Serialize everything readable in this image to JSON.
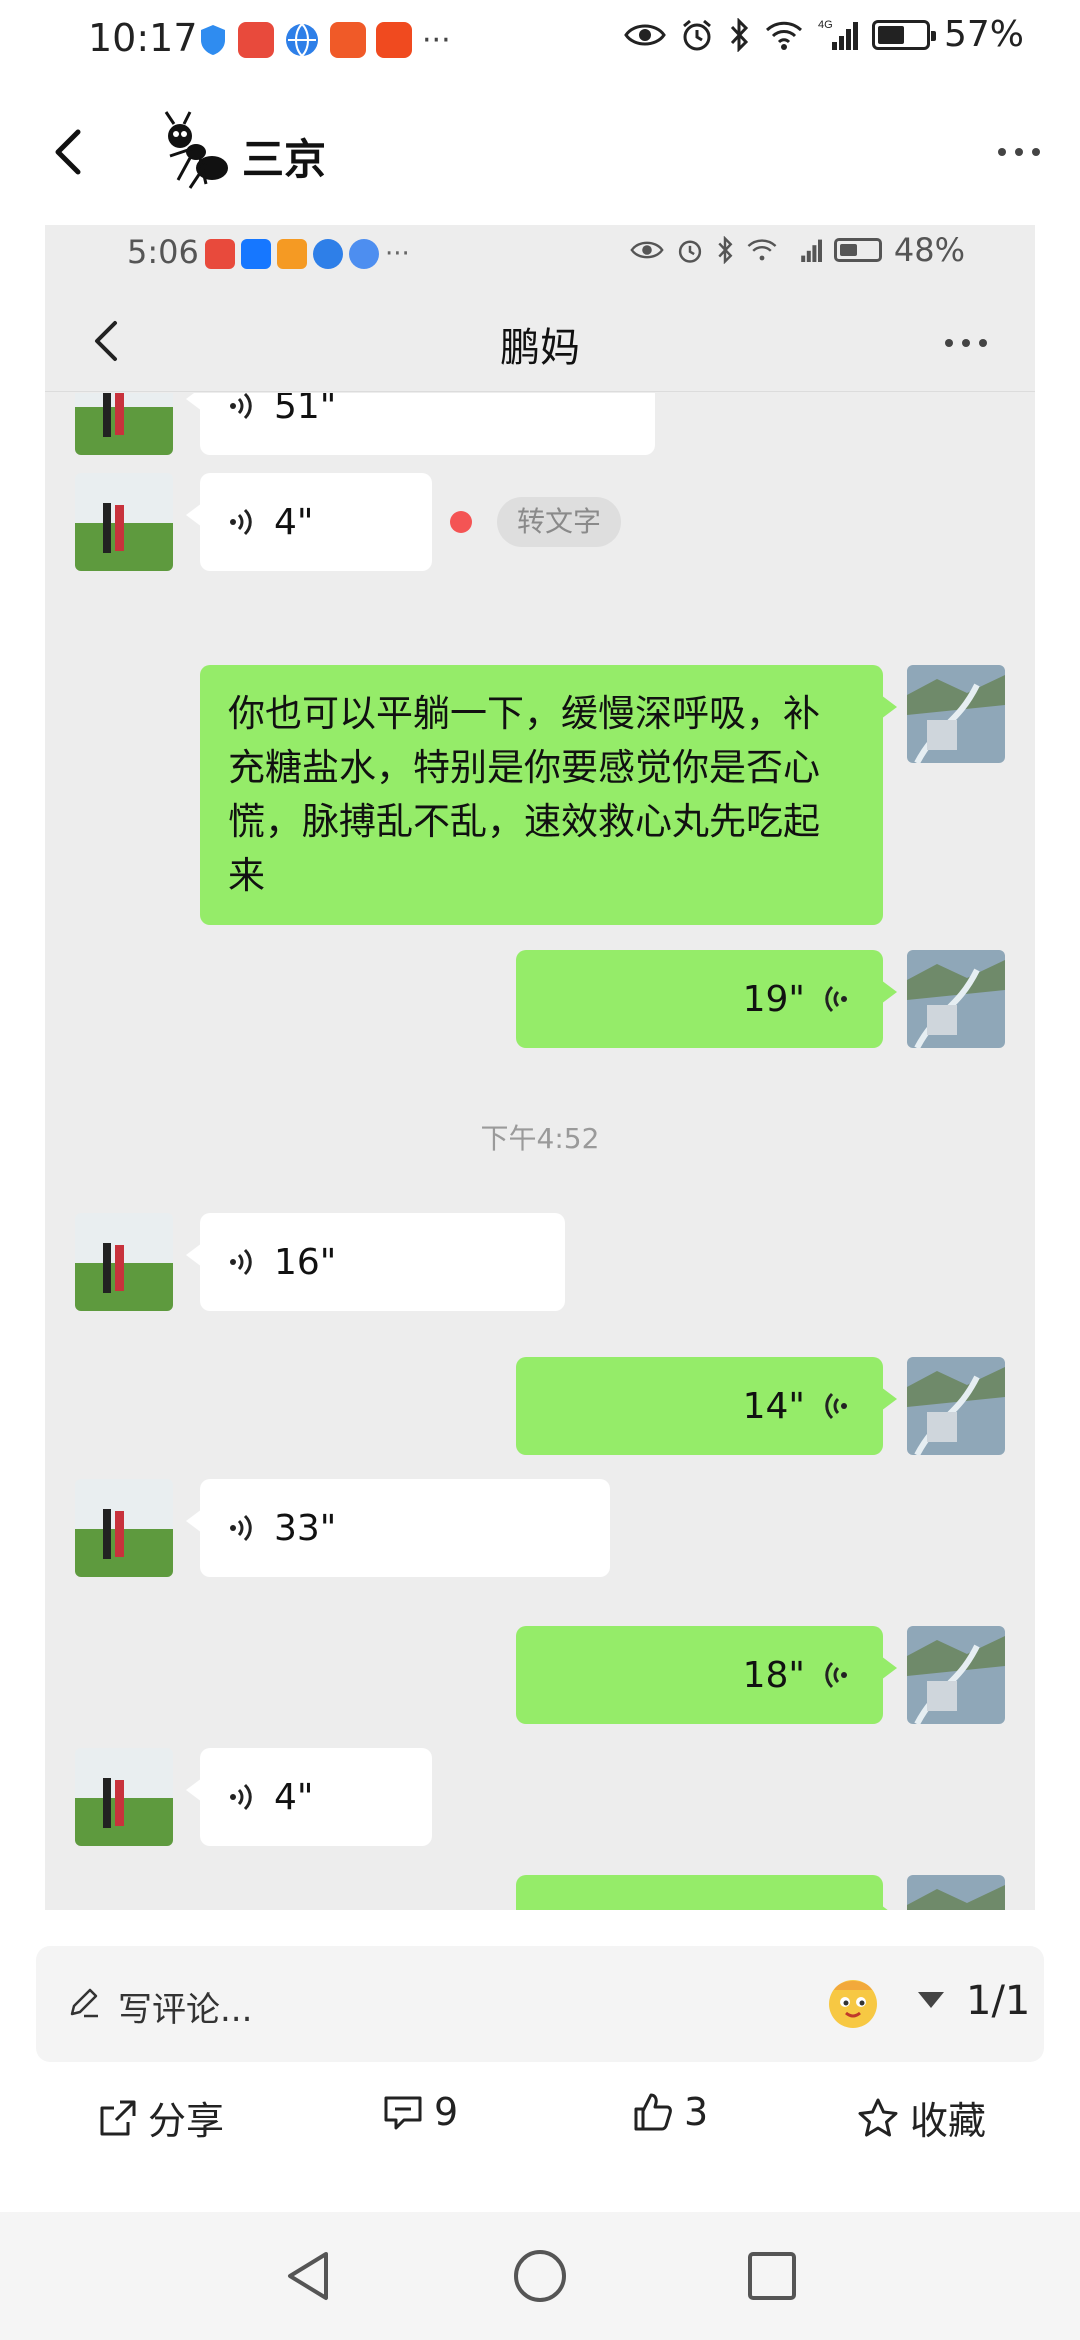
{
  "status_bar": {
    "time": "10:17",
    "battery": "57%",
    "battery_level": 0.57,
    "more_notifications": "···",
    "notification_icons": [
      "shield-icon",
      "huawei-app-icon",
      "browser-icon",
      "pingan-securities-icon",
      "pingan-bank-icon"
    ]
  },
  "header": {
    "author": "三京"
  },
  "screenshot": {
    "status_time": "5:06",
    "status_more": "···",
    "status_battery": "48%",
    "battery_level": 0.48,
    "chat_title": "鹏妈",
    "messages": {
      "m1_duration": "51\"",
      "m2_duration": "4\"",
      "m2_convert": "转文字",
      "m3_text": "你也可以平躺一下，缓慢深呼吸，补充糖盐水，特别是你要感觉你是否心慌，脉搏乱不乱，速效救心丸先吃起来",
      "m4_duration": "19\"",
      "time_separator": "下午4:52",
      "m5_duration": "16\"",
      "m6_duration": "14\"",
      "m7_duration": "33\"",
      "m8_duration": "18\"",
      "m9_duration": "4\""
    }
  },
  "comment_bar": {
    "placeholder": "写评论...",
    "page_indicator": "1/1"
  },
  "actions": {
    "share": "分享",
    "comments": "9",
    "likes": "3",
    "favorite": "收藏"
  },
  "colors": {
    "chat_background": "#ededed",
    "outgoing_bubble": "#95ec69",
    "incoming_bubble": "#ffffff",
    "unread_dot": "#f45454"
  }
}
